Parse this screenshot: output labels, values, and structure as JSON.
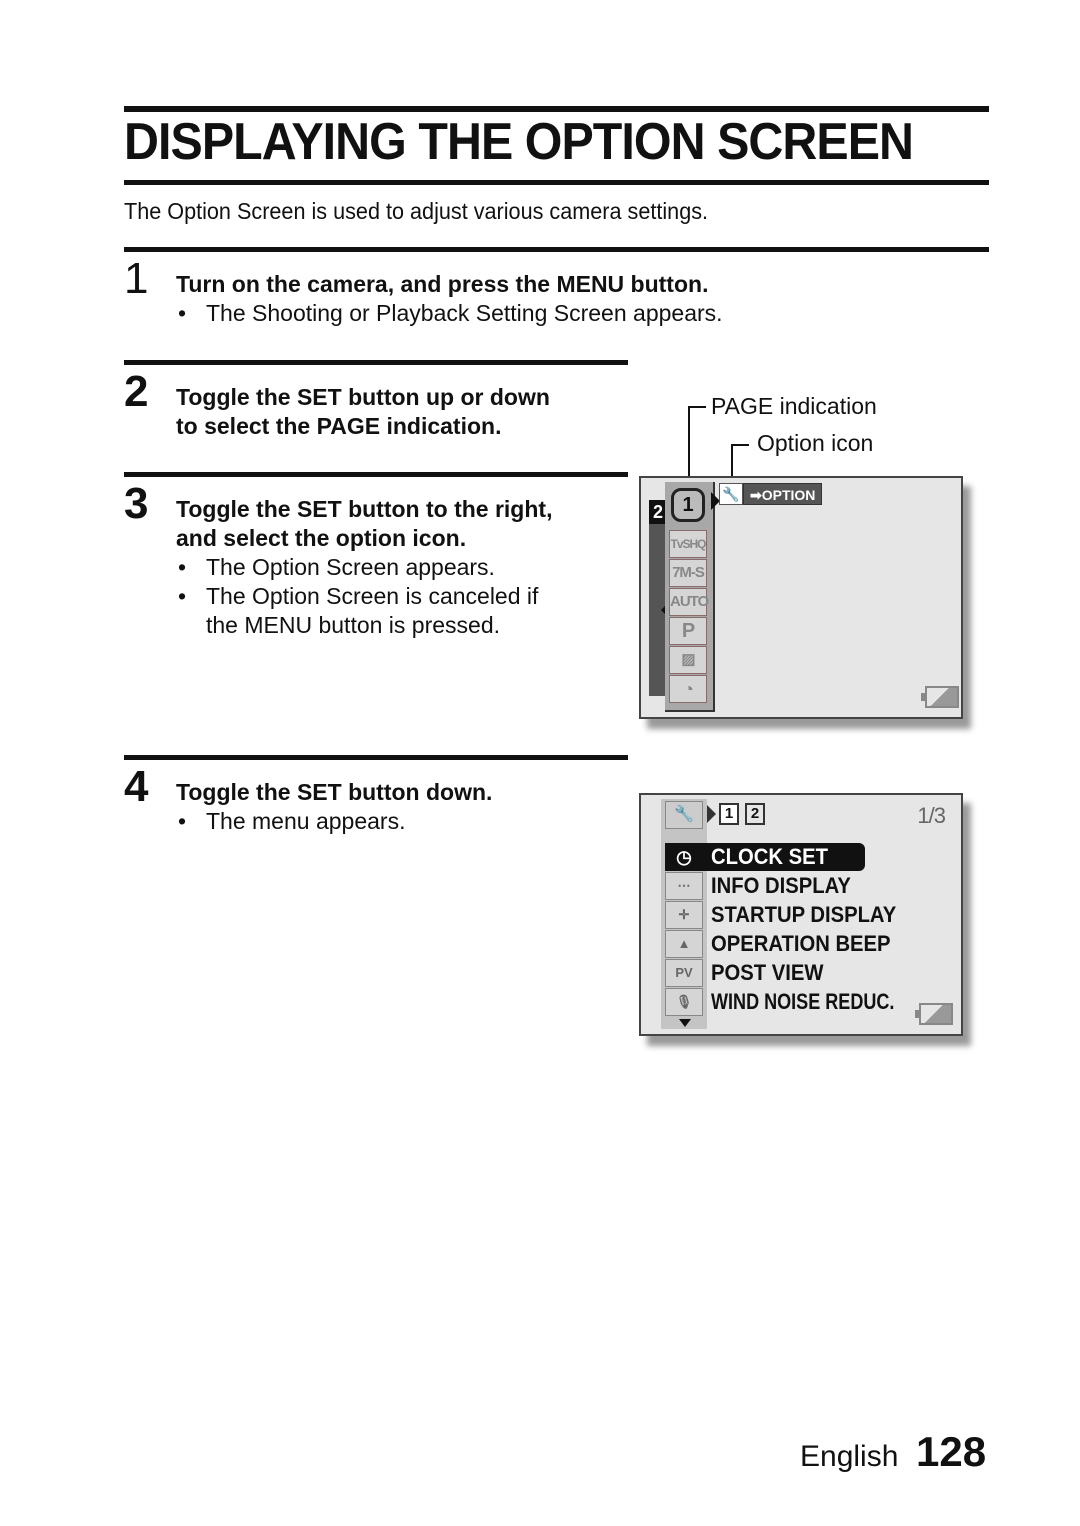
{
  "page": {
    "title": "DISPLAYING THE OPTION SCREEN",
    "intro": "The Option Screen is used to adjust various camera settings."
  },
  "steps": [
    {
      "number": "1",
      "heading": "Turn on the camera, and press the MENU button.",
      "bullets": [
        "The Shooting or Playback Setting Screen appears."
      ]
    },
    {
      "number": "2",
      "heading_lines": [
        "Toggle the SET button up or down",
        "to select the PAGE indication."
      ]
    },
    {
      "number": "3",
      "heading_lines": [
        "Toggle the SET button to the right,",
        "and select the option icon."
      ],
      "bullets": [
        {
          "lines": [
            "The Option Screen appears."
          ]
        },
        {
          "lines": [
            "The Option Screen is canceled if",
            "the MENU button is pressed."
          ]
        }
      ]
    },
    {
      "number": "4",
      "heading": "Toggle the SET button down.",
      "bullets": [
        "The menu appears."
      ]
    }
  ],
  "bullet_glyph": "•",
  "callouts": {
    "page_indication": "PAGE indication",
    "option_icon": "Option icon"
  },
  "screen1": {
    "page_inactive": "2",
    "page_active": "1",
    "option_icon": "wrench-icon",
    "option_icon_glyph": "🔧",
    "option_label": "➡OPTION",
    "mode_icons": [
      "TvSHQ",
      "7M-S",
      "AUTO",
      "P",
      "▨",
      "◔"
    ]
  },
  "screen2": {
    "tab_icon_glyph": "🔧",
    "pages": [
      "1",
      "2"
    ],
    "page_indicator": "1/3",
    "menu_items": [
      {
        "icon": "clock-icon",
        "glyph": "◷",
        "label": "CLOCK SET",
        "selected": true
      },
      {
        "icon": "info-display-icon",
        "glyph": "⋯",
        "label": "INFO DISPLAY",
        "selected": false
      },
      {
        "icon": "startup-display-icon",
        "glyph": "✛",
        "label": "STARTUP DISPLAY",
        "selected": false
      },
      {
        "icon": "bell-icon",
        "glyph": "▲",
        "label": "OPERATION BEEP",
        "selected": false
      },
      {
        "icon": "post-view-icon",
        "glyph": "PV",
        "label": "POST VIEW",
        "selected": false
      },
      {
        "icon": "wind-noise-icon",
        "glyph": "🎙",
        "label": "WIND NOISE REDUC.",
        "selected": false
      }
    ]
  },
  "footer": {
    "language": "English",
    "page_number": "128"
  }
}
